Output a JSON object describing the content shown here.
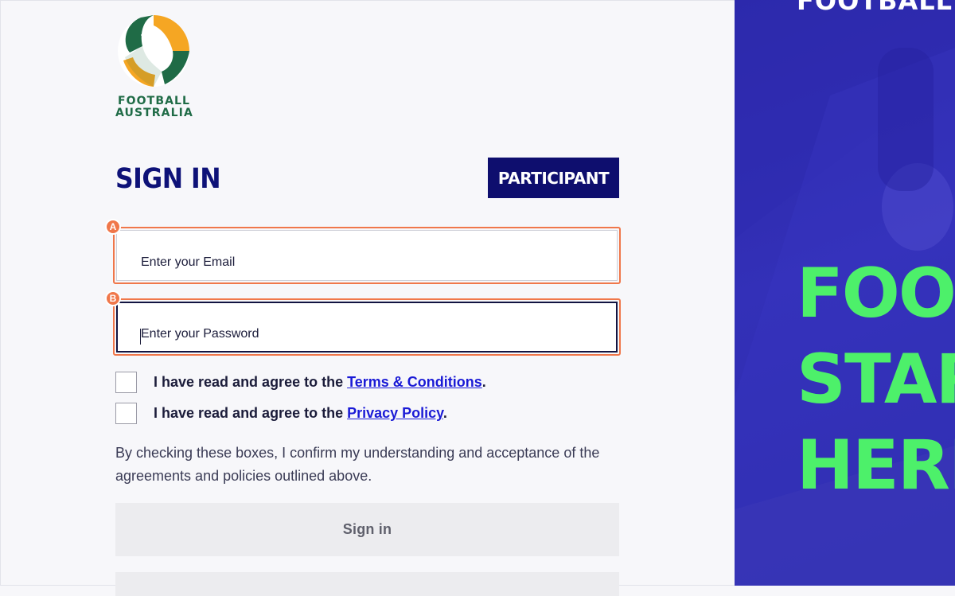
{
  "brand": {
    "line1": "FOOTBALL",
    "line2": "AUSTRALIA",
    "green": "#1f6b46",
    "gold": "#f5a623"
  },
  "header": {
    "title": "SIGN IN",
    "badge": "PARTICIPANT"
  },
  "form": {
    "email": {
      "placeholder": "Enter your Email",
      "value": ""
    },
    "password": {
      "placeholder": "Enter your Password",
      "value": ""
    },
    "markers": {
      "a": "A",
      "b": "B"
    },
    "terms": {
      "prefix": "I have read and agree to the ",
      "link": "Terms & Conditions",
      "suffix": ".",
      "checked": false
    },
    "privacy": {
      "prefix": "I have read and agree to the ",
      "link": "Privacy Policy",
      "suffix": ".",
      "checked": false
    },
    "confirm_text": "By checking these boxes, I confirm my understanding and acceptance of the agreements and policies outlined above.",
    "signin_label": "Sign in"
  },
  "hero": {
    "top_text": "FOOTBALL",
    "lines": [
      "FOO",
      "STAR",
      "HERE"
    ],
    "accent": "#4df06a",
    "background": "#2c2aa8"
  }
}
